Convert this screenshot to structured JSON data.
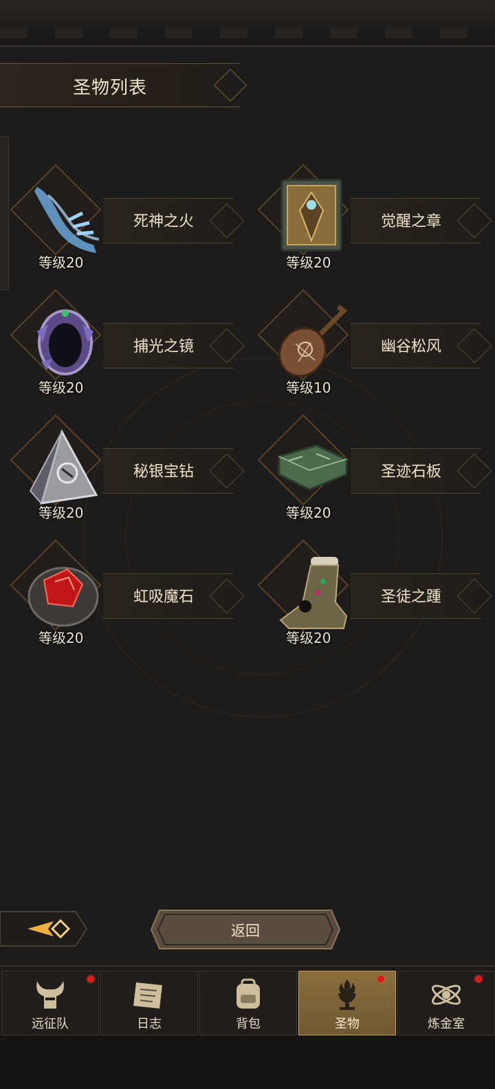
{
  "header": {
    "title": "圣物列表"
  },
  "relics": [
    {
      "name": "死神之火",
      "level": "等级20",
      "icon": "blue-spectral-hand"
    },
    {
      "name": "觉醒之章",
      "level": "等级20",
      "icon": "ornate-tome"
    },
    {
      "name": "捕光之镜",
      "level": "等级20",
      "icon": "crystal-mirror"
    },
    {
      "name": "幽谷松风",
      "level": "等级10",
      "icon": "lute"
    },
    {
      "name": "秘银宝钻",
      "level": "等级20",
      "icon": "silver-pyramid"
    },
    {
      "name": "圣迹石板",
      "level": "等级20",
      "icon": "green-stone-tablet"
    },
    {
      "name": "虹吸魔石",
      "level": "等级20",
      "icon": "red-gem-fur"
    },
    {
      "name": "圣徒之踵",
      "level": "等级20",
      "icon": "jeweled-foot"
    }
  ],
  "actions": {
    "return_label": "返回"
  },
  "tabs": [
    {
      "label": "远征队",
      "icon": "horned-helmet-icon",
      "badge": true,
      "active": false
    },
    {
      "label": "日志",
      "icon": "scroll-icon",
      "badge": false,
      "active": false
    },
    {
      "label": "背包",
      "icon": "backpack-icon",
      "badge": false,
      "active": false
    },
    {
      "label": "圣物",
      "icon": "chalice-icon",
      "badge": true,
      "active": true
    },
    {
      "label": "炼金室",
      "icon": "alchemy-icon",
      "badge": true,
      "active": false
    }
  ],
  "colors": {
    "accent": "#c4a061",
    "badge": "#e01818",
    "background": "#1d1c1b"
  }
}
